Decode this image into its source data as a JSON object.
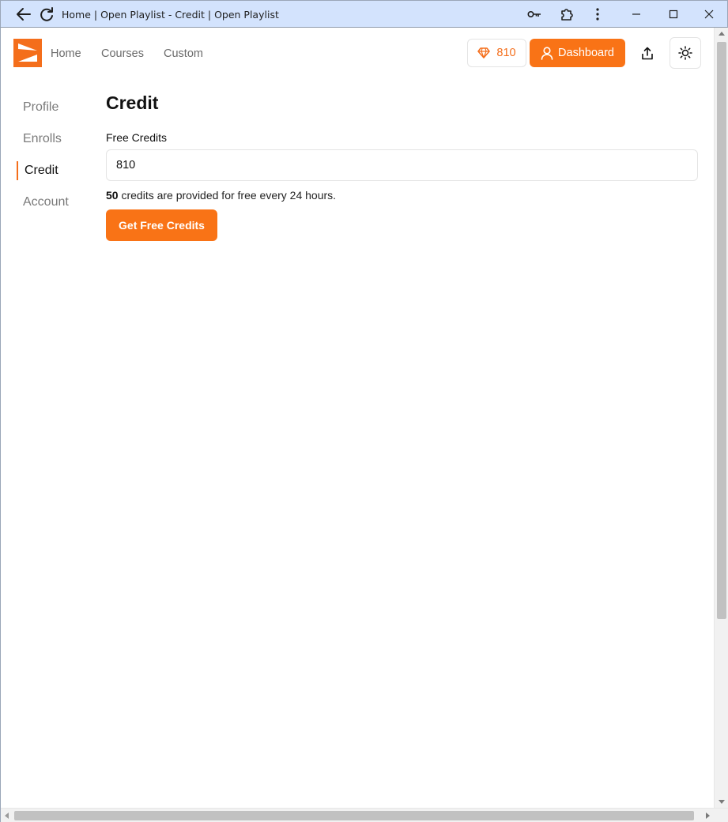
{
  "browser": {
    "title": "Home | Open Playlist - Credit | Open Playlist"
  },
  "header": {
    "nav": [
      {
        "label": "Home"
      },
      {
        "label": "Courses"
      },
      {
        "label": "Custom"
      }
    ],
    "credits_count": "810",
    "dashboard_label": "Dashboard"
  },
  "sidebar": {
    "items": [
      {
        "label": "Profile",
        "active": false
      },
      {
        "label": "Enrolls",
        "active": false
      },
      {
        "label": "Credit",
        "active": true
      },
      {
        "label": "Account",
        "active": false
      }
    ]
  },
  "main": {
    "title": "Credit",
    "field_label": "Free Credits",
    "field_value": "810",
    "info_amount": "50",
    "info_text": " credits are provided for free every 24 hours.",
    "button_label": "Get Free Credits"
  },
  "colors": {
    "accent": "#f97316",
    "brand": "#f46e1b",
    "chrome": "#d3e3fd"
  },
  "icons": {
    "back": "arrow-left-icon",
    "reload": "reload-icon",
    "key": "key-icon",
    "extension": "puzzle-icon",
    "menu": "kebab-menu-icon",
    "gem": "gem-icon",
    "user": "user-icon",
    "share": "share-icon",
    "theme": "sun-icon"
  }
}
